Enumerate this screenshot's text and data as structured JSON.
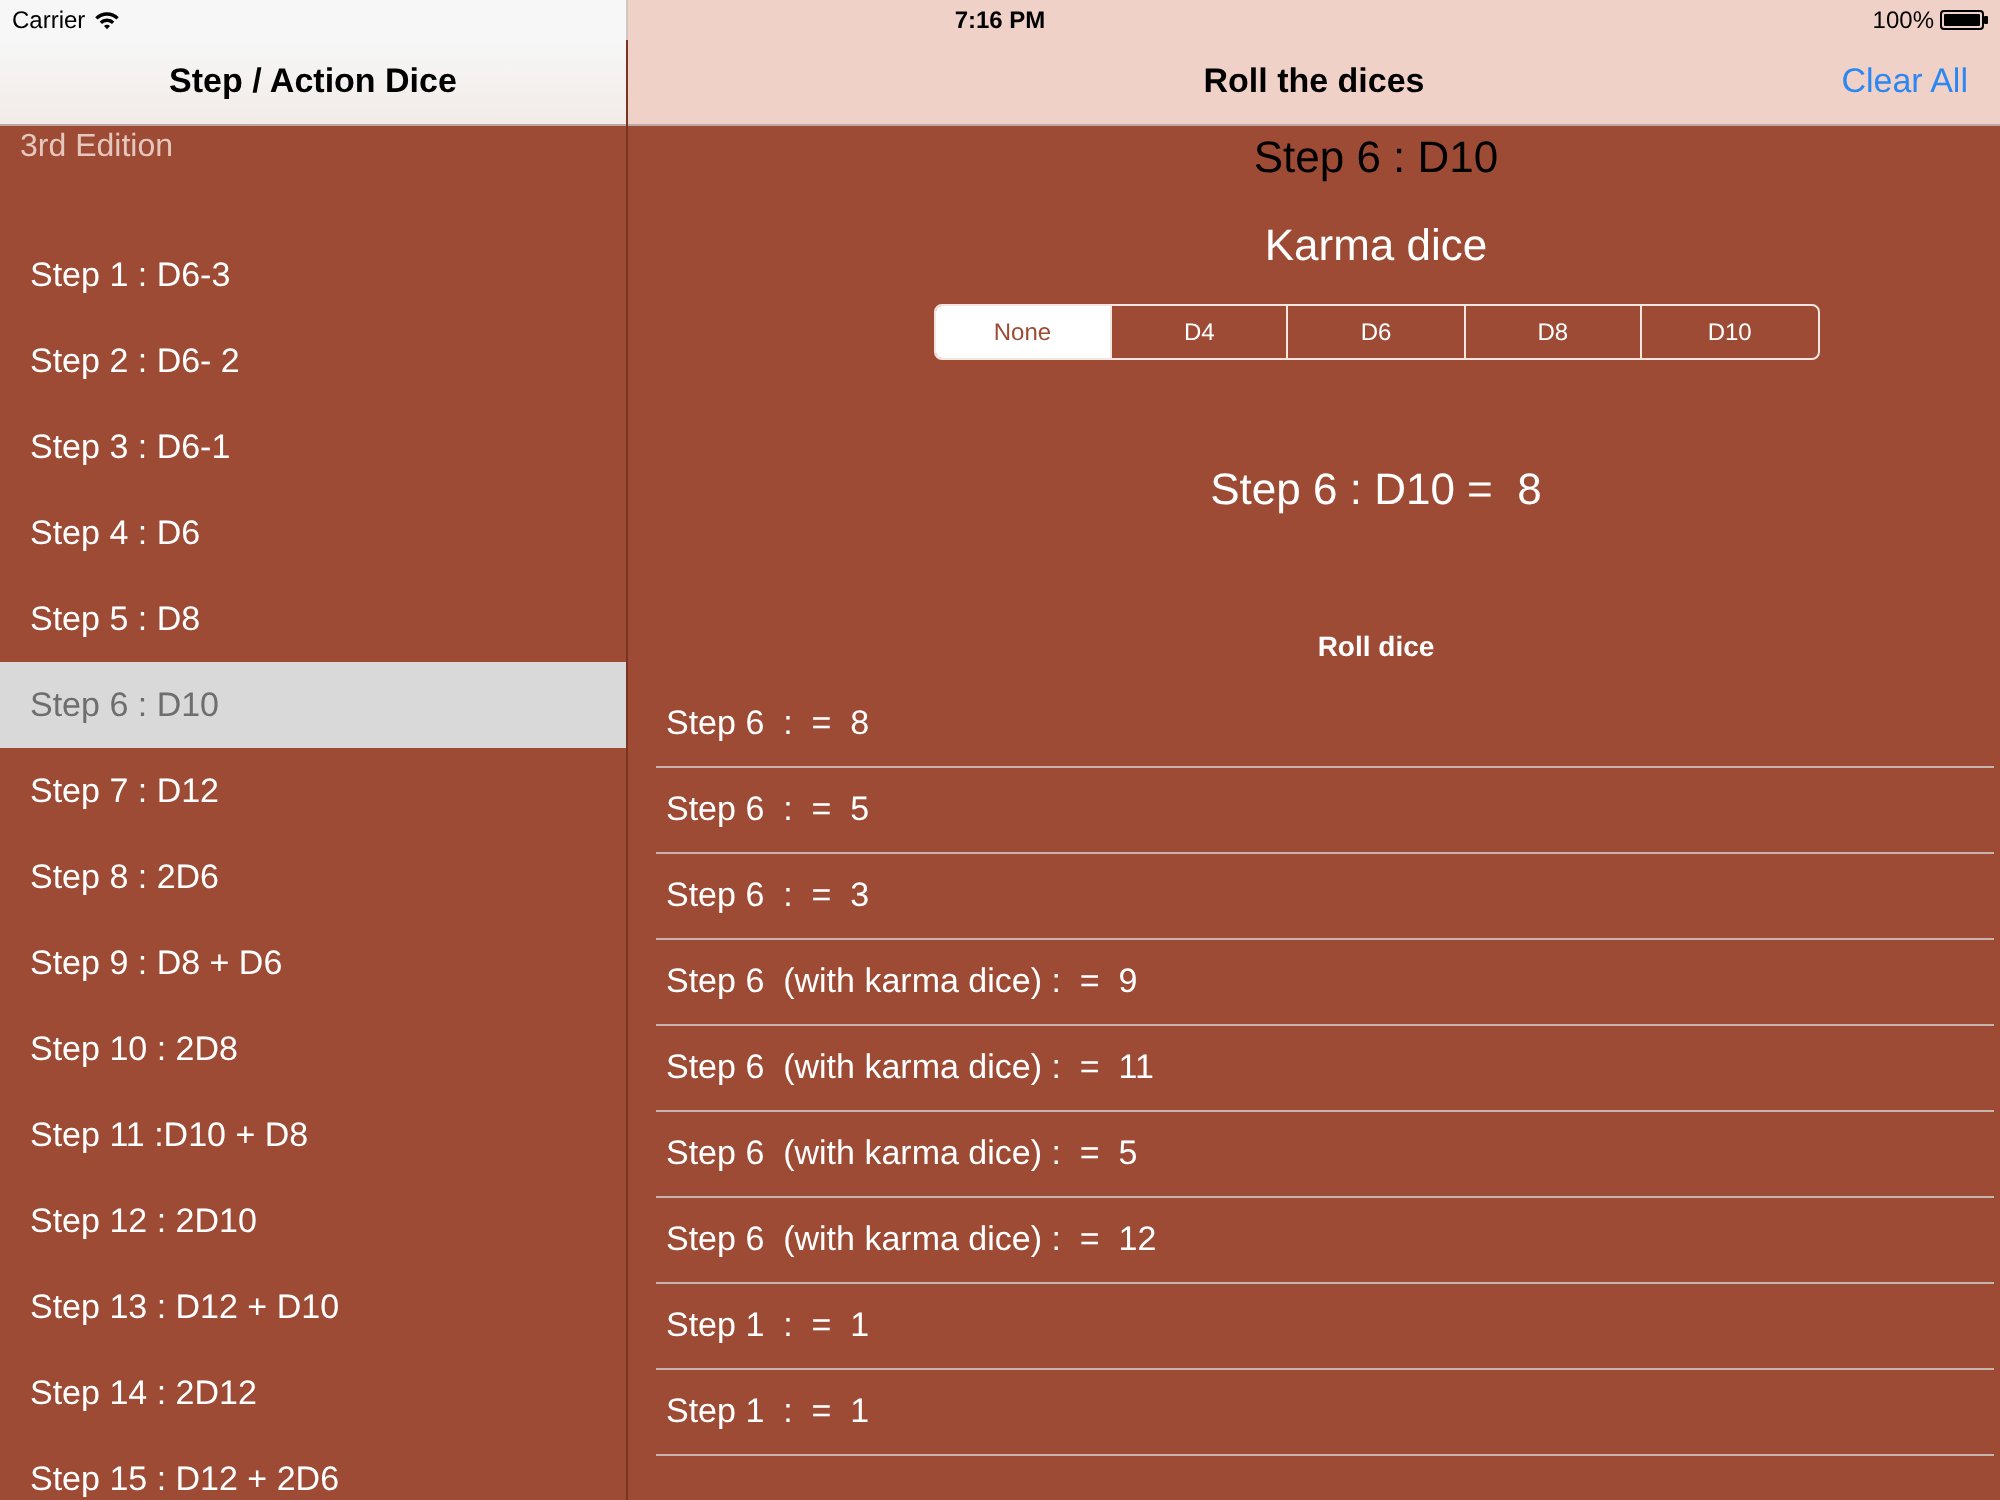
{
  "status_bar": {
    "carrier": "Carrier",
    "time": "7:16 PM",
    "battery": "100%"
  },
  "master": {
    "title": "Step / Action Dice",
    "section": "3rd Edition",
    "items": [
      {
        "label": "Step 1 : D6-3",
        "selected": false
      },
      {
        "label": "Step 2 : D6- 2",
        "selected": false
      },
      {
        "label": "Step 3 : D6-1",
        "selected": false
      },
      {
        "label": "Step 4 : D6",
        "selected": false
      },
      {
        "label": "Step 5 : D8",
        "selected": false
      },
      {
        "label": "Step 6 : D10",
        "selected": true
      },
      {
        "label": "Step 7 : D12",
        "selected": false
      },
      {
        "label": "Step 8 : 2D6",
        "selected": false
      },
      {
        "label": "Step 9 : D8 + D6",
        "selected": false
      },
      {
        "label": "Step 10 : 2D8",
        "selected": false
      },
      {
        "label": "Step 11 :D10 + D8",
        "selected": false
      },
      {
        "label": "Step 12 : 2D10",
        "selected": false
      },
      {
        "label": "Step 13 : D12 + D10",
        "selected": false
      },
      {
        "label": "Step 14 : 2D12",
        "selected": false
      },
      {
        "label": "Step 15 : D12 + 2D6",
        "selected": false
      }
    ]
  },
  "detail": {
    "title": "Roll the dices",
    "clear_button": "Clear All",
    "heading": "Step 6 : D10",
    "karma_label": "Karma dice",
    "karma_options": [
      {
        "label": "None",
        "selected": true
      },
      {
        "label": "D4",
        "selected": false
      },
      {
        "label": "D6",
        "selected": false
      },
      {
        "label": "D8",
        "selected": false
      },
      {
        "label": "D10",
        "selected": false
      }
    ],
    "result": "Step 6 : D10 =  8",
    "roll_button": "Roll dice",
    "rolls": [
      "Step 6  :  =  8",
      "Step 6  :  =  5",
      "Step 6  :  =  3",
      "Step 6  (with karma dice) :  =  9",
      "Step 6  (with karma dice) :  =  11",
      "Step 6  (with karma dice) :  =  5",
      "Step 6  (with karma dice) :  =  12",
      "Step 1  :  =  1",
      "Step 1  :  =  1"
    ]
  }
}
